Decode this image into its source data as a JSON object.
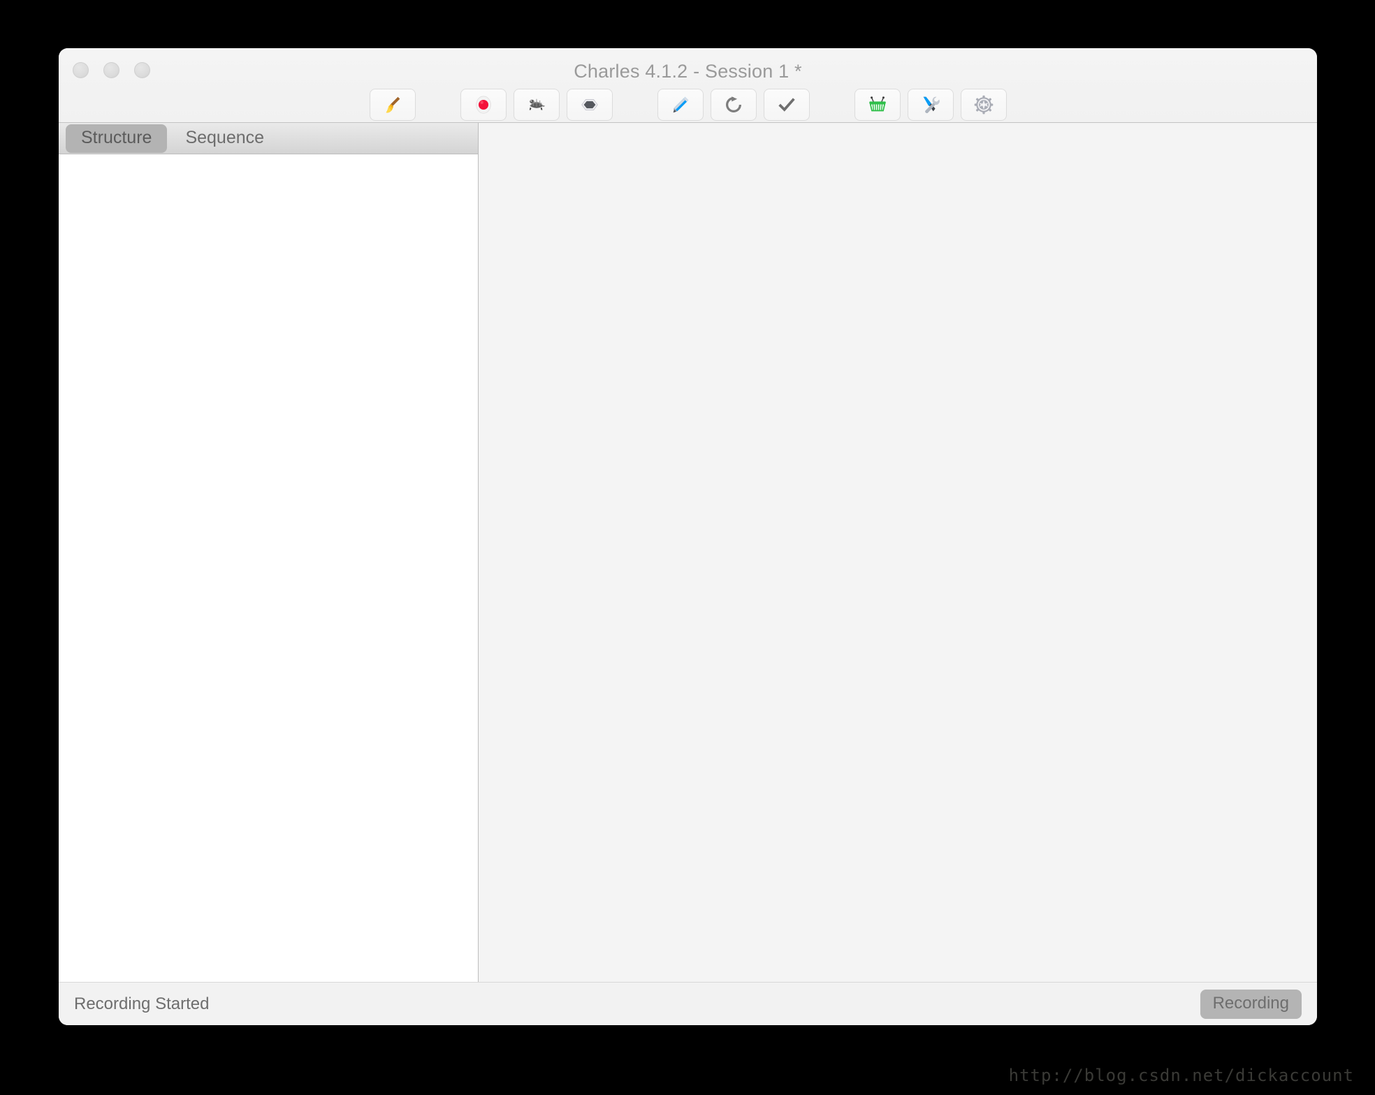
{
  "window": {
    "title": "Charles 4.1.2 - Session 1 *",
    "traffic_lights": [
      {
        "name": "close",
        "color": "#dcdcdc"
      },
      {
        "name": "minimize",
        "color": "#dcdcdc"
      },
      {
        "name": "zoom",
        "color": "#dcdcdc"
      }
    ]
  },
  "toolbar": {
    "buttons": [
      {
        "icon": "broom-icon",
        "label": "Clear the current session"
      },
      {
        "icon": "record-icon",
        "label": "Start/Stop Recording"
      },
      {
        "icon": "turtle-icon",
        "label": "Start/Stop Throttling"
      },
      {
        "icon": "hexagon-icon",
        "label": "Enable/Disable Breakpoints"
      },
      {
        "icon": "pen-icon",
        "label": "Compose a new request"
      },
      {
        "icon": "refresh-icon",
        "label": "Repeat the request"
      },
      {
        "icon": "checkmark-icon",
        "label": "Validate"
      },
      {
        "icon": "basket-icon",
        "label": "Tools"
      },
      {
        "icon": "tools-icon",
        "label": "Repeat Advanced"
      },
      {
        "icon": "gear-icon",
        "label": "Settings"
      }
    ]
  },
  "left_pane": {
    "tabs": [
      {
        "label": "Structure",
        "active": true
      },
      {
        "label": "Sequence",
        "active": false
      }
    ],
    "tree_items": []
  },
  "right_pane": {
    "content": ""
  },
  "status_bar": {
    "message": "Recording Started",
    "recording_badge": "Recording"
  },
  "watermark": {
    "text": "http://blog.csdn.net/dickaccount"
  },
  "colors": {
    "window_bg": "#f2f2f2",
    "pane_bg": "#f4f4f4",
    "tree_bg": "#ffffff",
    "tab_active": "#b3b3b3",
    "record_red": "#f4123a",
    "basket_green": "#2fbf4a",
    "pen_blue": "#0a9cf5",
    "text_gray": "#6e6e6e"
  }
}
